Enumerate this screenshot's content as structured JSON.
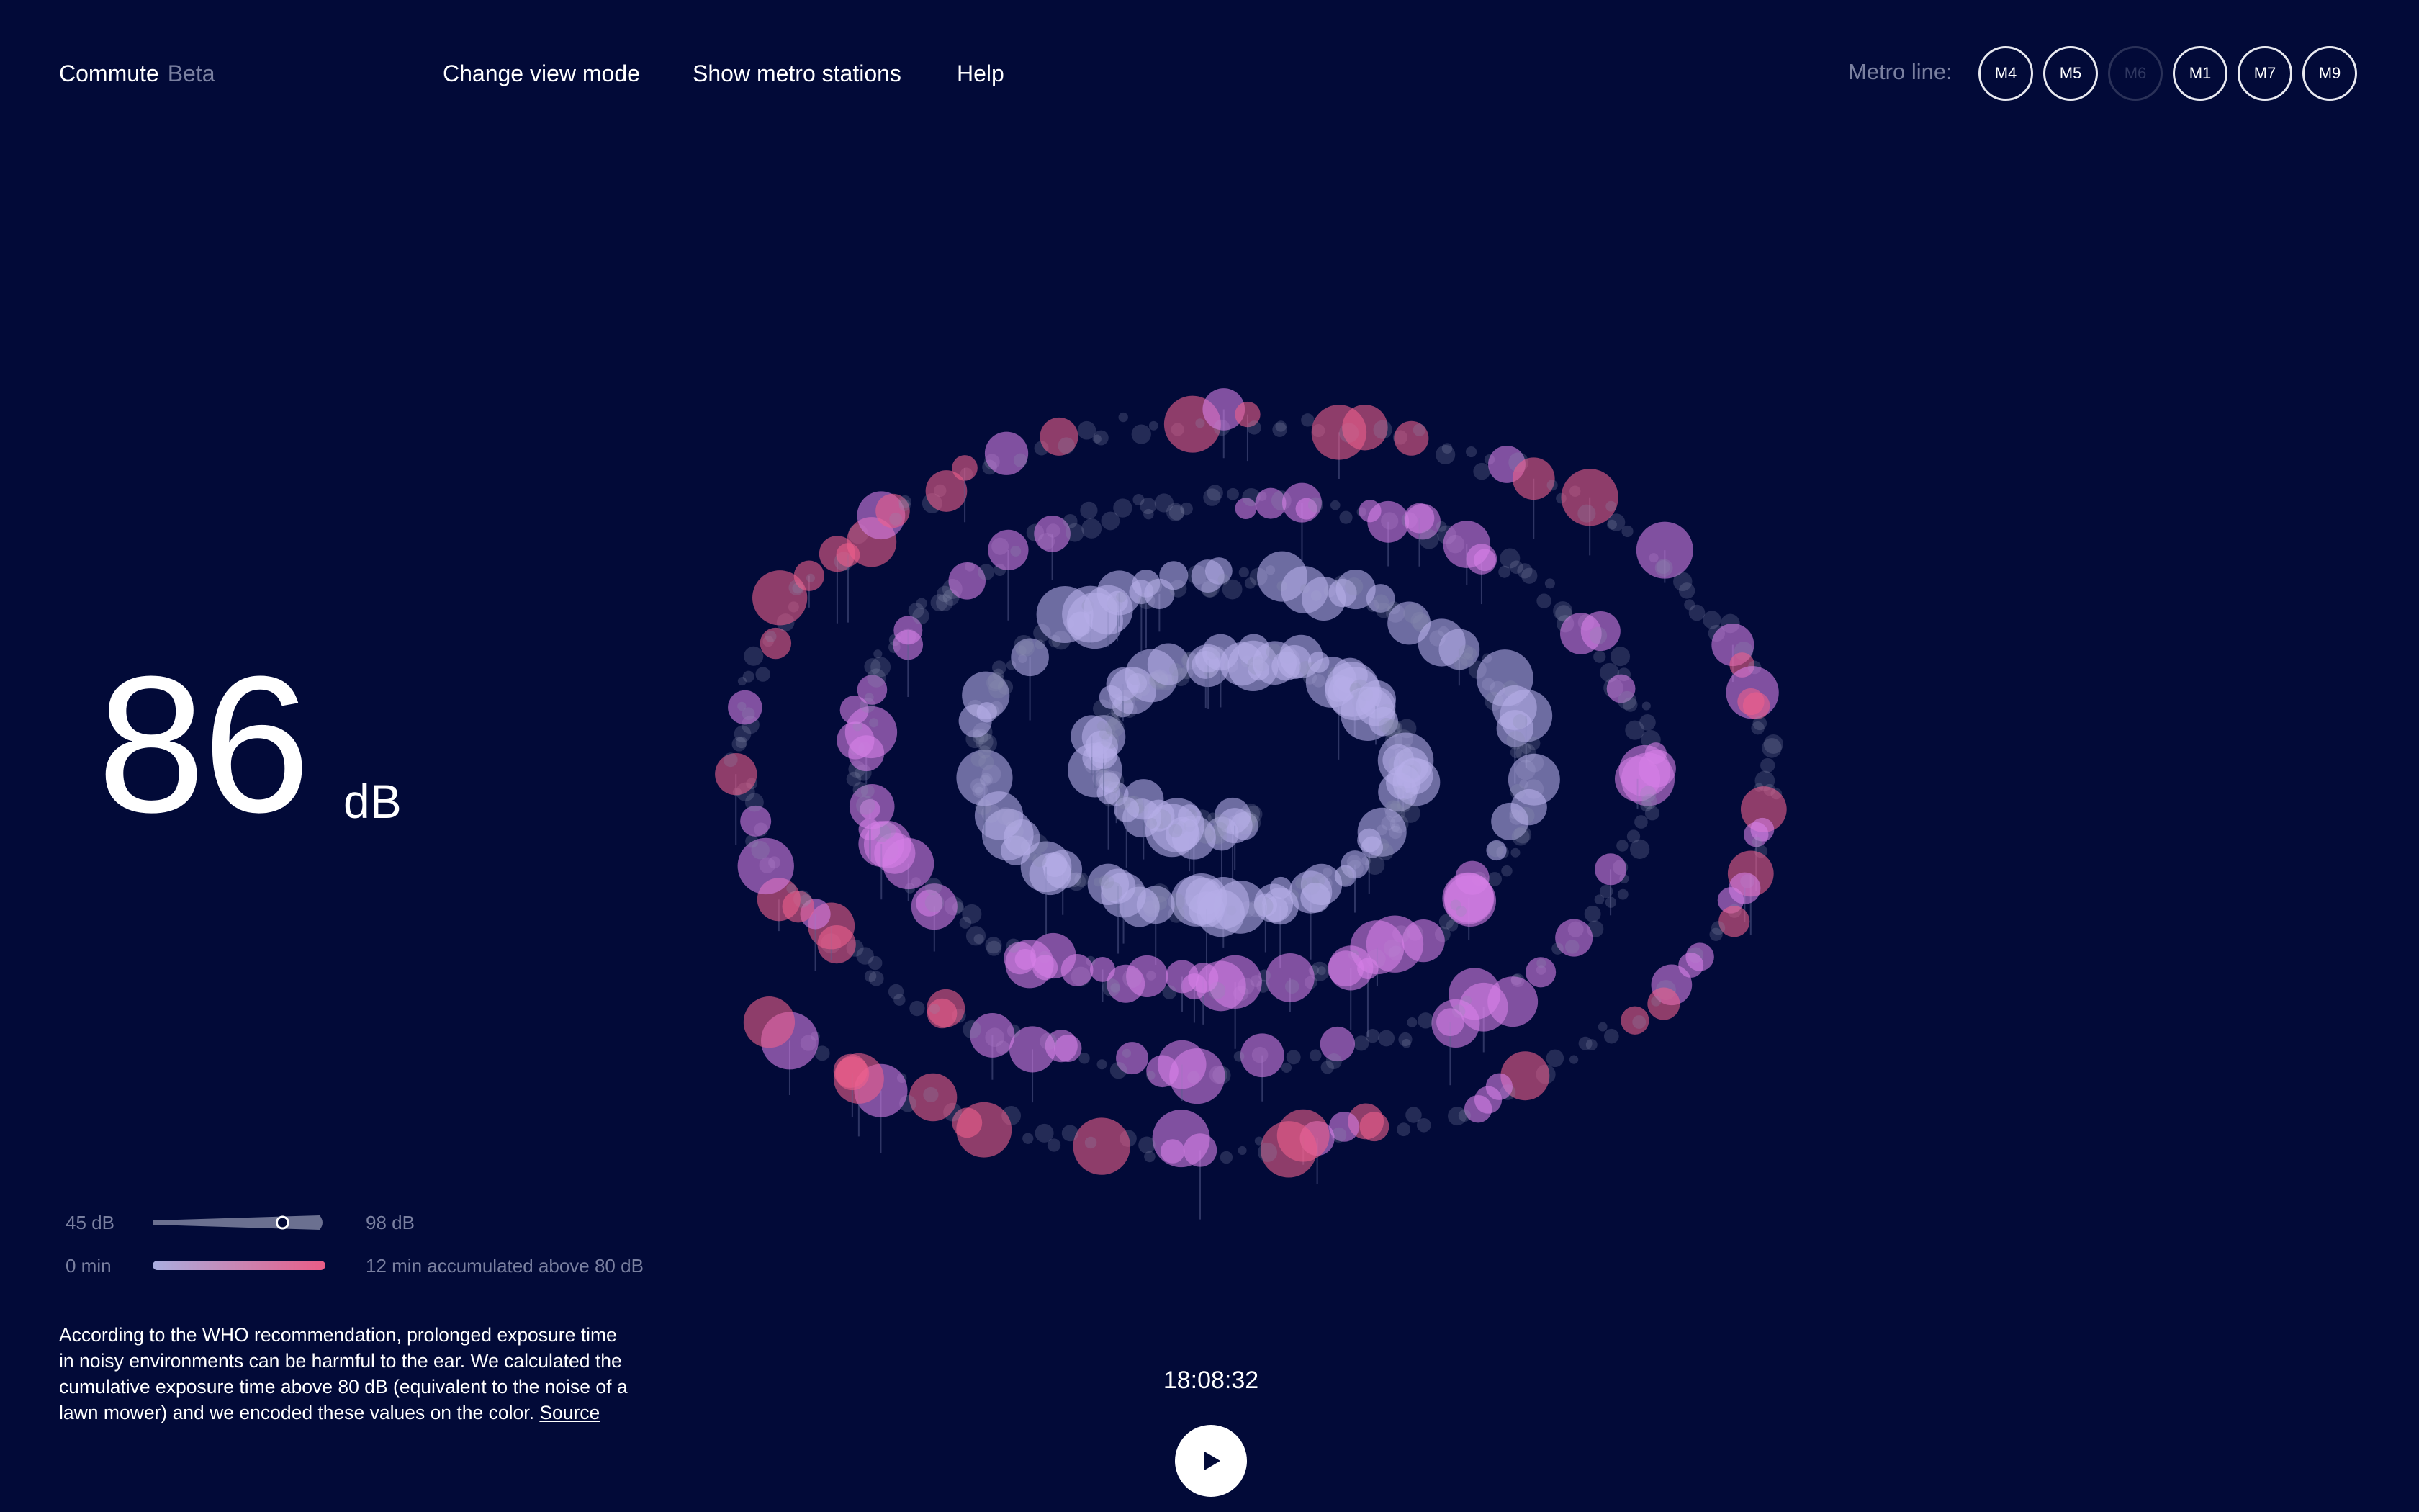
{
  "header": {
    "app_name": "Commute",
    "badge": "Beta",
    "nav": [
      "Change view mode",
      "Show metro stations",
      "Help"
    ],
    "metro_label": "Metro line:",
    "metro_lines": [
      {
        "label": "M4",
        "active": true
      },
      {
        "label": "M5",
        "active": true
      },
      {
        "label": "M6",
        "active": false
      },
      {
        "label": "M1",
        "active": true
      },
      {
        "label": "M7",
        "active": true
      },
      {
        "label": "M9",
        "active": true
      }
    ]
  },
  "reading": {
    "value": "86",
    "unit": "dB"
  },
  "legend": {
    "min_db": "45 dB",
    "max_db": "98 dB",
    "level_fraction": 0.774,
    "min_time": "0 min",
    "max_time": "12 min accumulated above 80 dB",
    "colors": {
      "low": "#a9aee0",
      "high": "#ea5c86"
    }
  },
  "description": {
    "text": "According to the WHO recommendation, prolonged exposure time in noisy environments can be harmful to the ear. We calculated the cumulative exposure time above 80 dB (equivalent to the noise of a lawn mower) and we encoded these values on the color.",
    "link": "Source"
  },
  "playback": {
    "time": "18:08:32",
    "icon": "play-icon"
  },
  "colors": {
    "background": "#020a38",
    "lavender": "#b6aee8",
    "violet": "#d67fe6",
    "pink": "#ec5f8c"
  }
}
